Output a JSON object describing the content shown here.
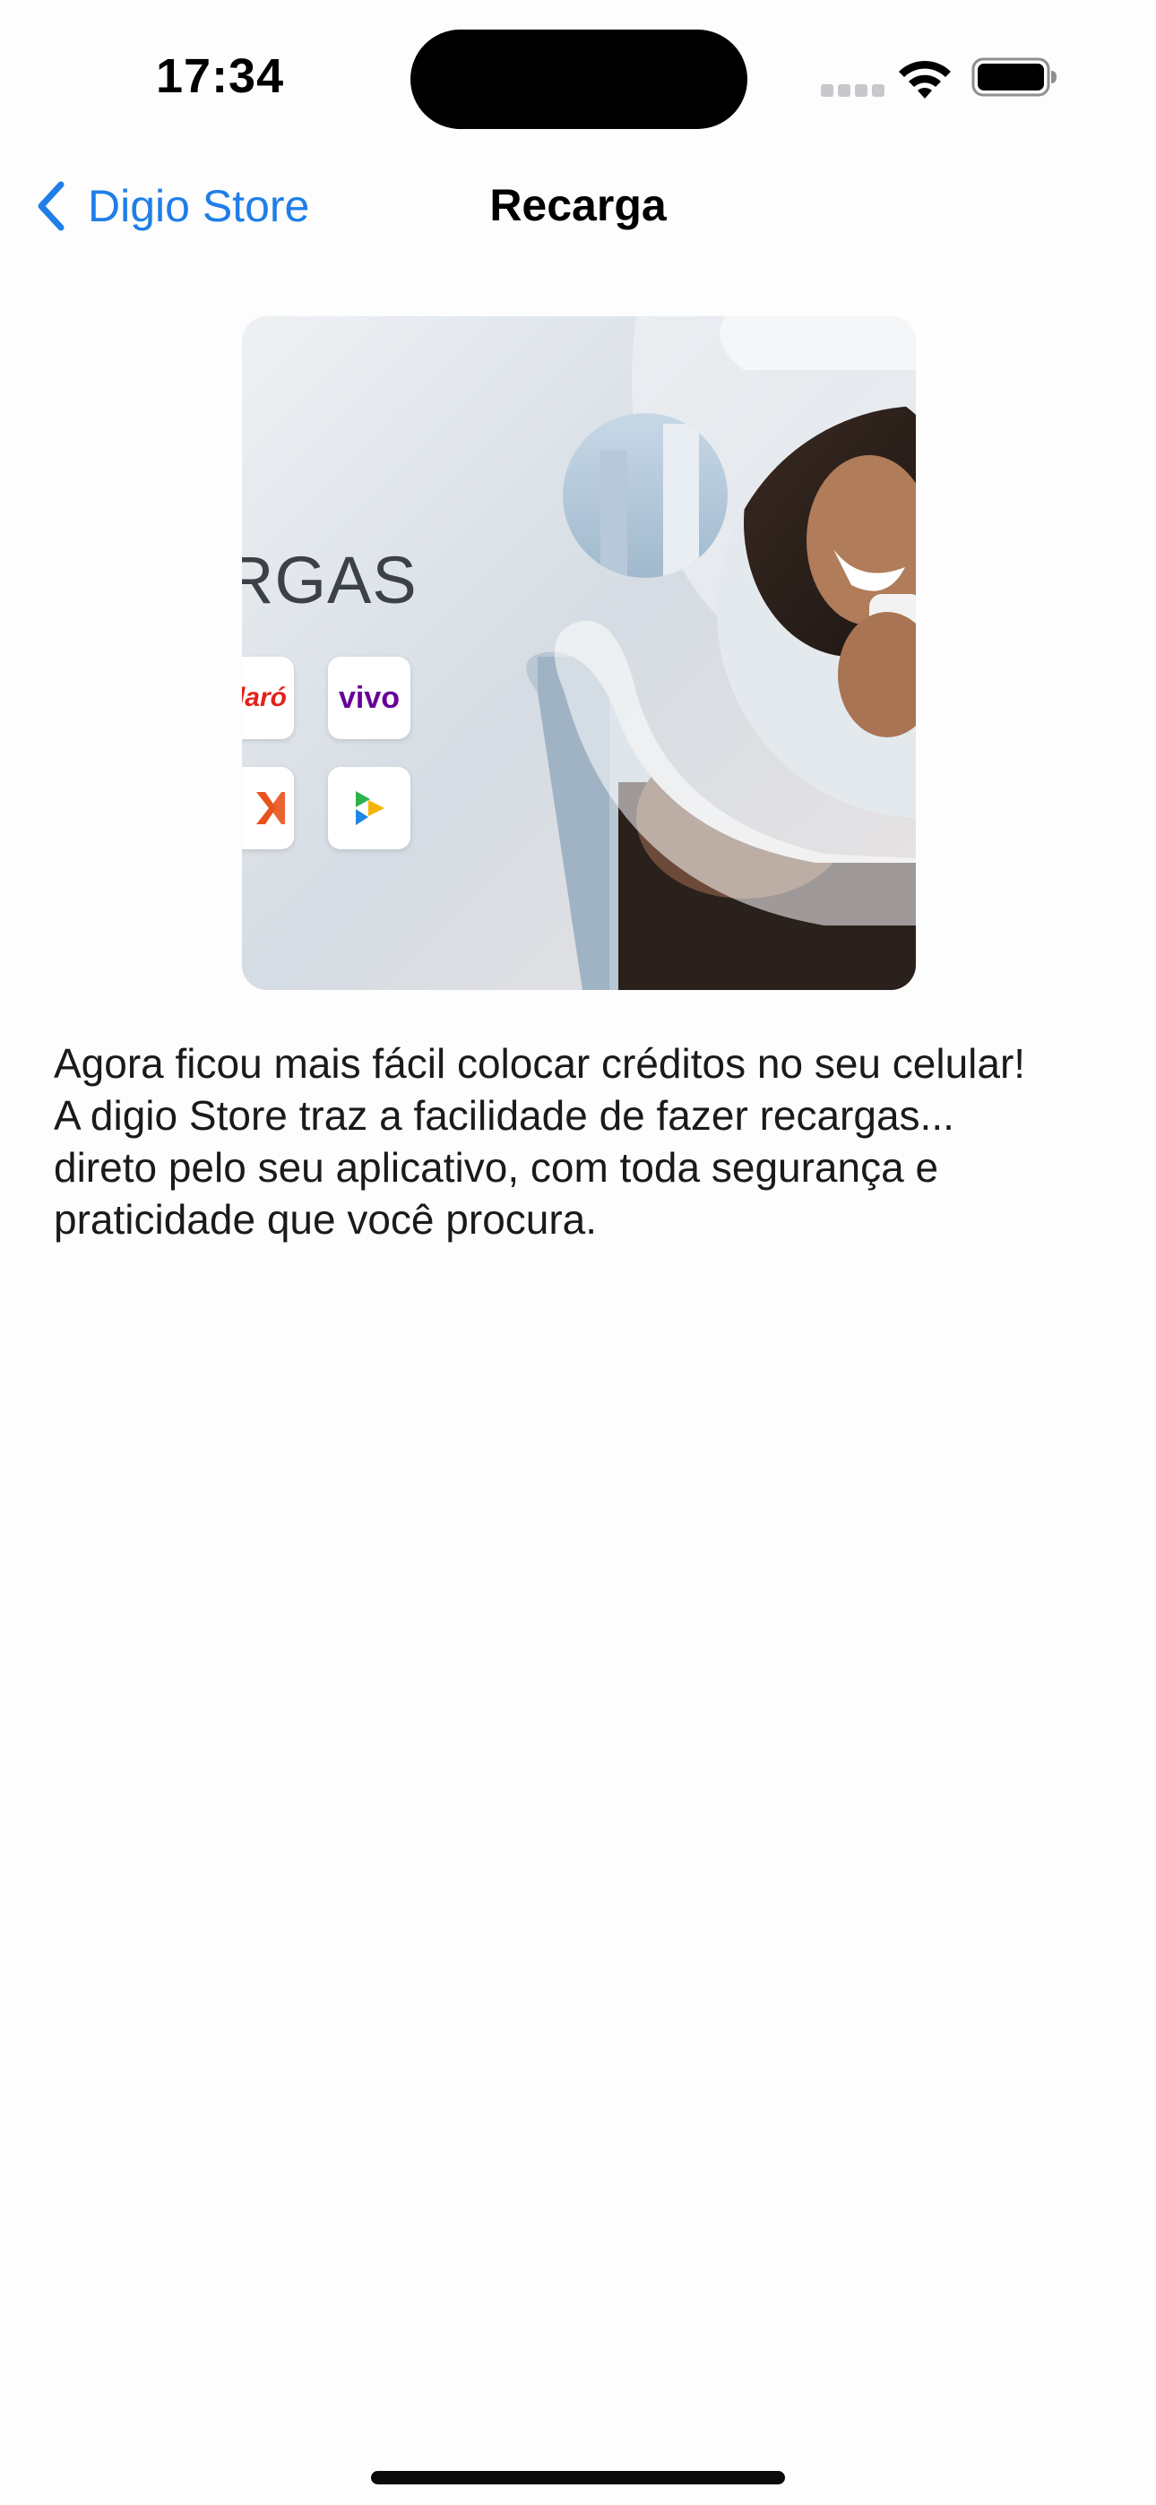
{
  "status_bar": {
    "time": "17:34",
    "icons": [
      "cellular-signal-icon",
      "wifi-icon",
      "battery-icon"
    ]
  },
  "nav": {
    "back_label": "Digio Store",
    "title": "Recarga"
  },
  "banner": {
    "heading": "RGAS",
    "operators": [
      "laró",
      "vivo"
    ],
    "icons": [
      "claro-logo-icon",
      "vivo-logo-icon",
      "tim-logo-icon",
      "play-logo-icon"
    ]
  },
  "description": "Agora ficou mais fácil colocar créditos no seu celular!\nA digio Store traz a facilidade de fazer recargas...\ndireto pelo seu aplicativo, com toda segurança e\npraticidade que você procura.",
  "colors": {
    "accent": "#1f7ee8",
    "claro": "#e2231a",
    "vivo": "#660099",
    "tim": "#e8531c"
  }
}
